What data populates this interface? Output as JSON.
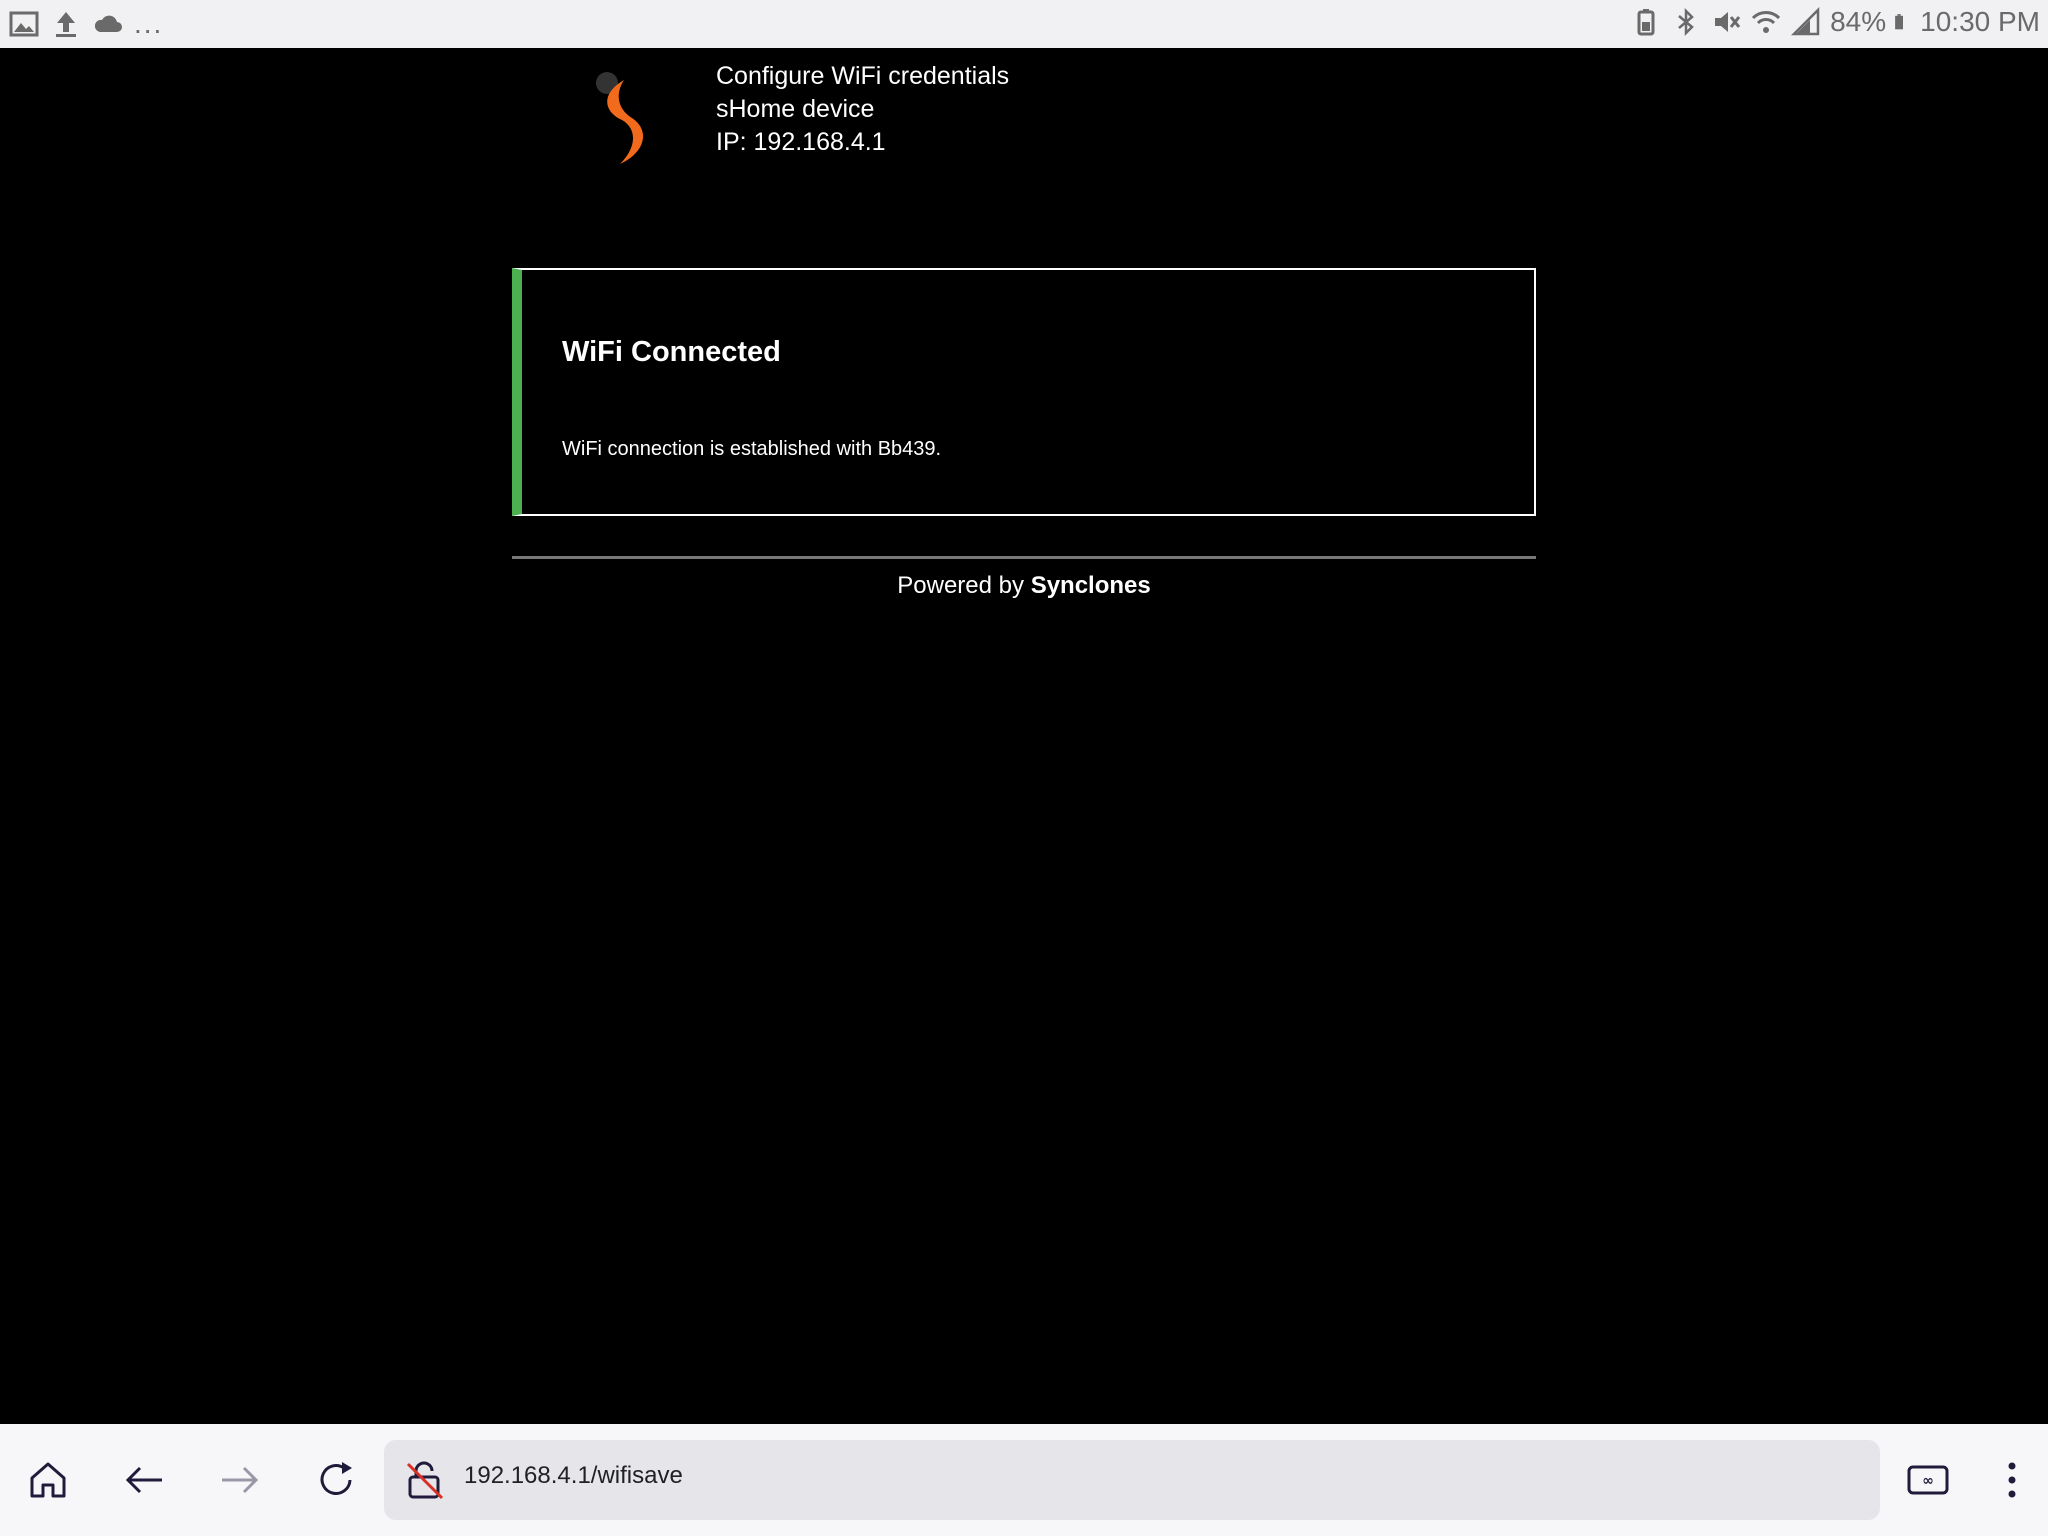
{
  "status_bar": {
    "left_icons": [
      "image-icon",
      "upload-icon",
      "cloud-icon"
    ],
    "overflow": "...",
    "battery": "84%",
    "time": "10:30 PM"
  },
  "header": {
    "line1": "Configure WiFi credentials",
    "line2": "sHome device",
    "line3": "IP: 192.168.4.1"
  },
  "alert": {
    "title": "WiFi Connected",
    "message": "WiFi connection is established with Bb439.",
    "accent_color": "#4caf50"
  },
  "footer": {
    "prefix": "Powered by",
    "brand": "Synclones"
  },
  "browser": {
    "url": "192.168.4.1/wifisave",
    "nav_icons": [
      "home-icon",
      "back-icon",
      "forward-icon",
      "reload-icon",
      "tab-switcher-icon",
      "menu-icon"
    ]
  },
  "colors": {
    "logo_orange": "#f26a1b",
    "logo_dot": "#333333"
  }
}
